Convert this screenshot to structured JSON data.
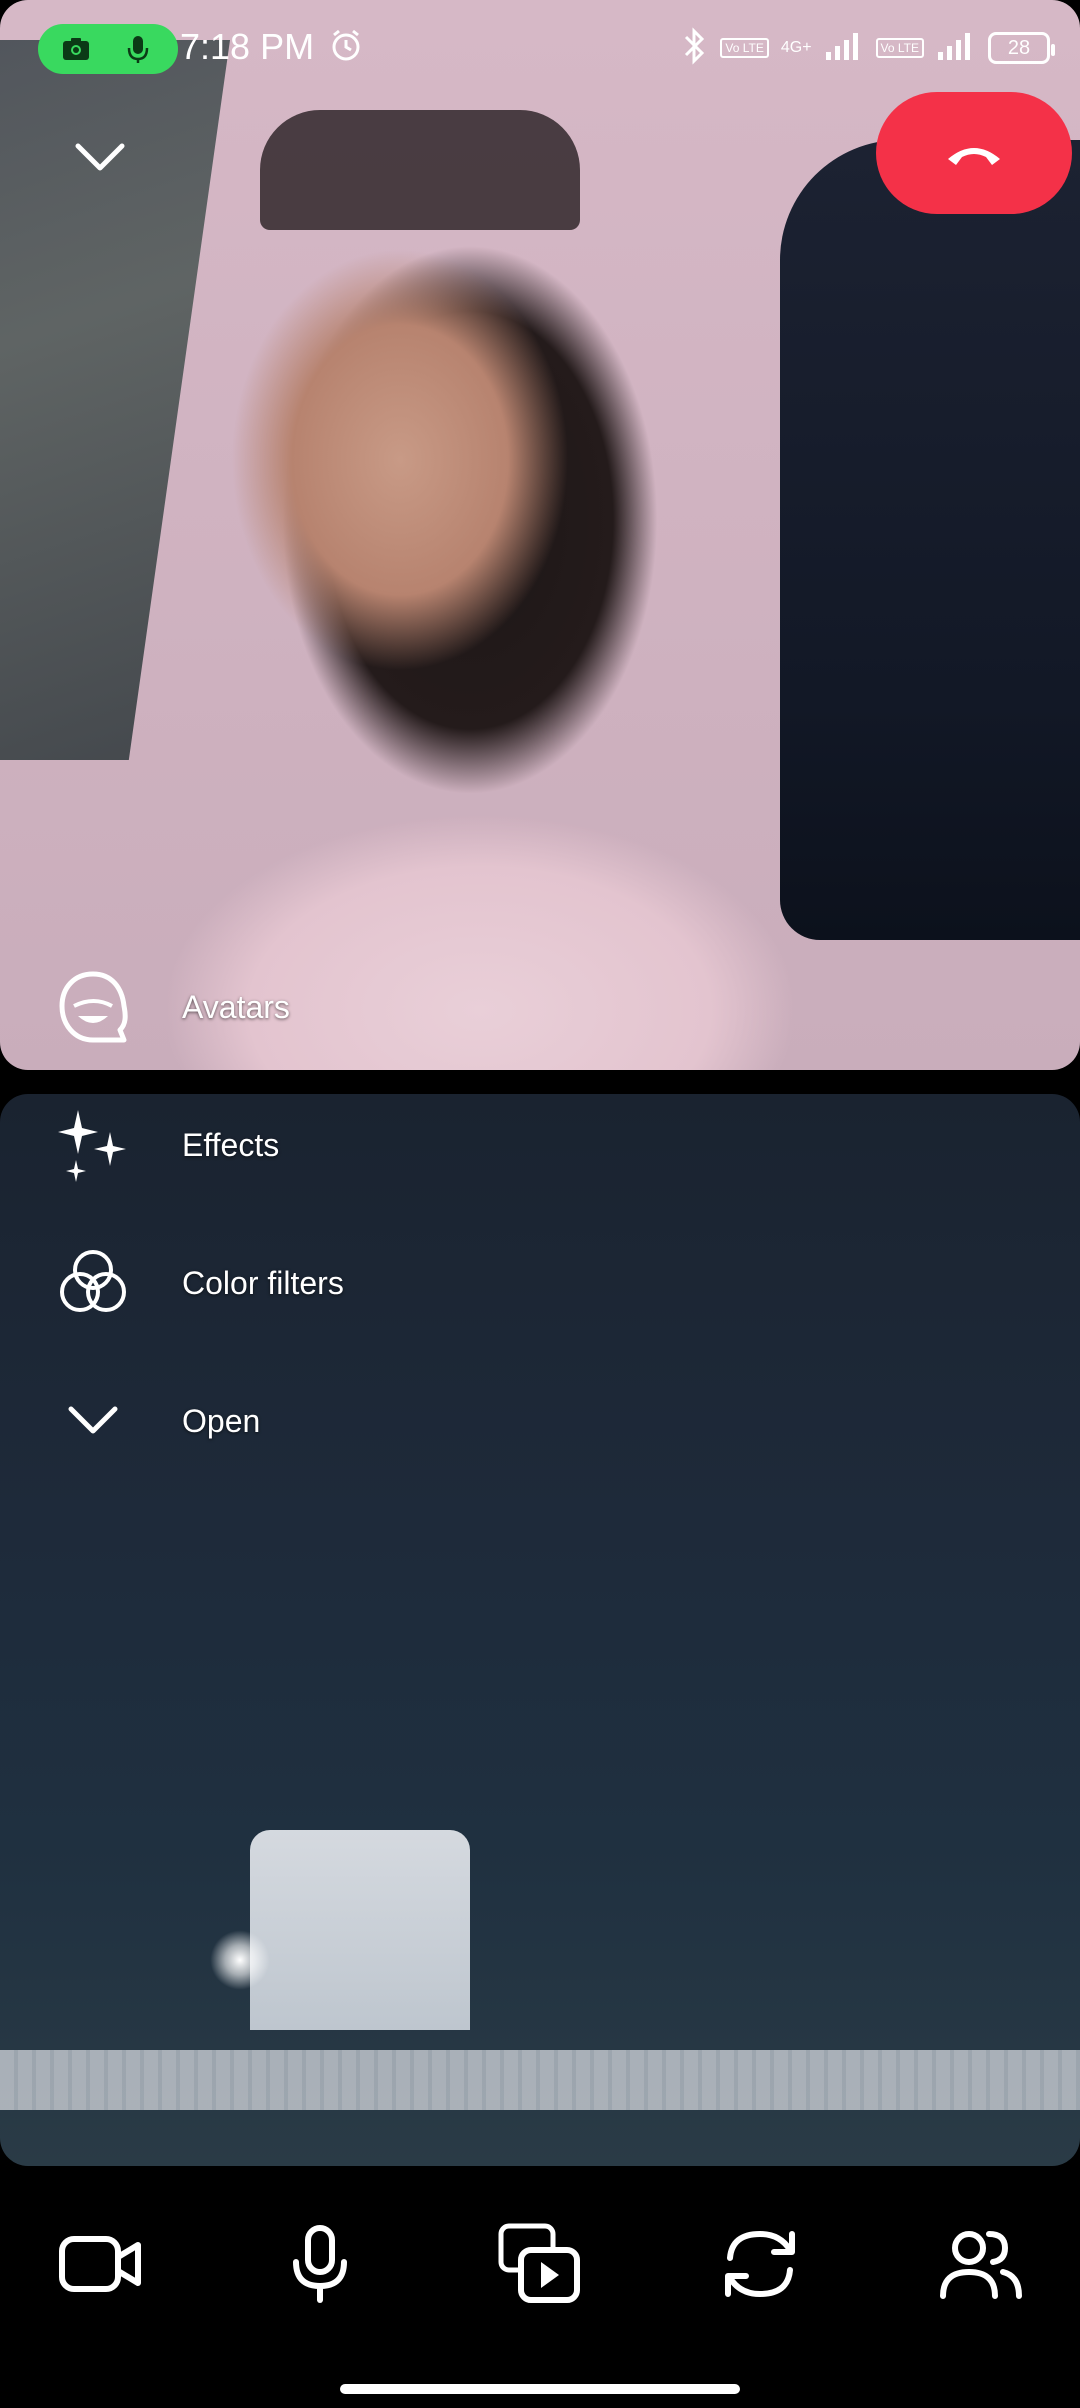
{
  "status_bar": {
    "time": "7:18 PM",
    "network_type": "4G+",
    "lte_badge_1": "Vo LTE",
    "lte_badge_2": "Vo LTE",
    "battery": "28"
  },
  "effects_menu": {
    "avatars": "Avatars",
    "effects": "Effects",
    "color_filters": "Color filters",
    "open": "Open"
  },
  "colors": {
    "end_call": "#f43148",
    "recording_pill": "#39d95f",
    "background": "#000000"
  },
  "icons": {
    "minimize": "chevron-down-icon",
    "end_call": "phone-hangup-icon",
    "avatars": "avatar-icon",
    "effects": "sparkles-icon",
    "color_filters": "color-filters-icon",
    "open": "chevron-down-icon",
    "camera": "video-camera-icon",
    "microphone": "microphone-icon",
    "share_media": "media-share-icon",
    "flip_camera": "flip-camera-icon",
    "participants": "people-icon"
  }
}
